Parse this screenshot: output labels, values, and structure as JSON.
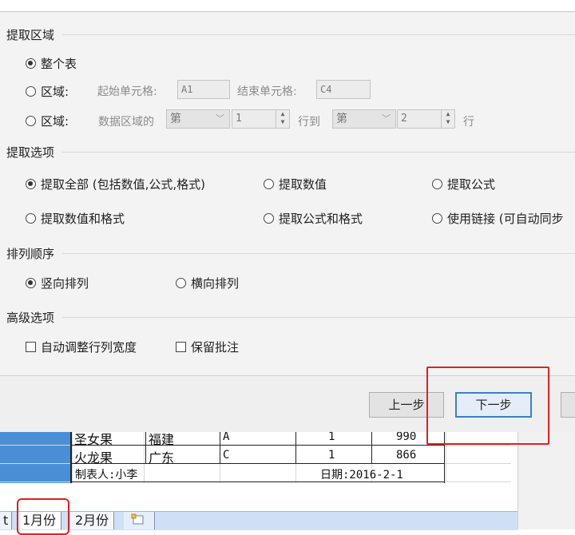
{
  "dialog": {
    "sections": {
      "extract_area": "提取区域",
      "extract_options": "提取选项",
      "sort_order": "排列顺序",
      "advanced": "高级选项"
    },
    "area": {
      "whole_table": "整个表",
      "range1_label": "区域:",
      "start_cell_label": "起始单元格:",
      "start_cell_value": "A1",
      "end_cell_label": "结束单元格:",
      "end_cell_value": "C4",
      "range2_label": "区域:",
      "data_range_label": "数据区域的",
      "from_ordinal": "第",
      "from_value": "1",
      "to_label": "行到",
      "to_ordinal": "第",
      "to_value": "2",
      "row_suffix": "行"
    },
    "options": {
      "all": "提取全部 (包括数值,公式,格式)",
      "values": "提取数值",
      "formulas": "提取公式",
      "values_formats": "提取数值和格式",
      "formulas_formats": "提取公式和格式",
      "link": "使用链接 (可自动同步"
    },
    "order": {
      "vertical": "竖向排列",
      "horizontal": "横向排列"
    },
    "advanced": {
      "auto_fit": "自动调整行列宽度",
      "keep_comments": "保留批注"
    },
    "buttons": {
      "prev": "上一步",
      "next": "下一步"
    },
    "highlight_color": "#e0201f"
  },
  "sheet": {
    "rows": [
      {
        "fruit": "圣女果",
        "origin": "福建",
        "grade": "A",
        "qty": "1",
        "price": "990"
      },
      {
        "fruit": "火龙果",
        "origin": "广东",
        "grade": "C",
        "qty": "1",
        "price": "866"
      }
    ],
    "maker": "制表人:小李",
    "date": "日期:2016-2-1",
    "tabs": {
      "partial": "t",
      "jan": "1月份",
      "feb": "2月份"
    }
  }
}
